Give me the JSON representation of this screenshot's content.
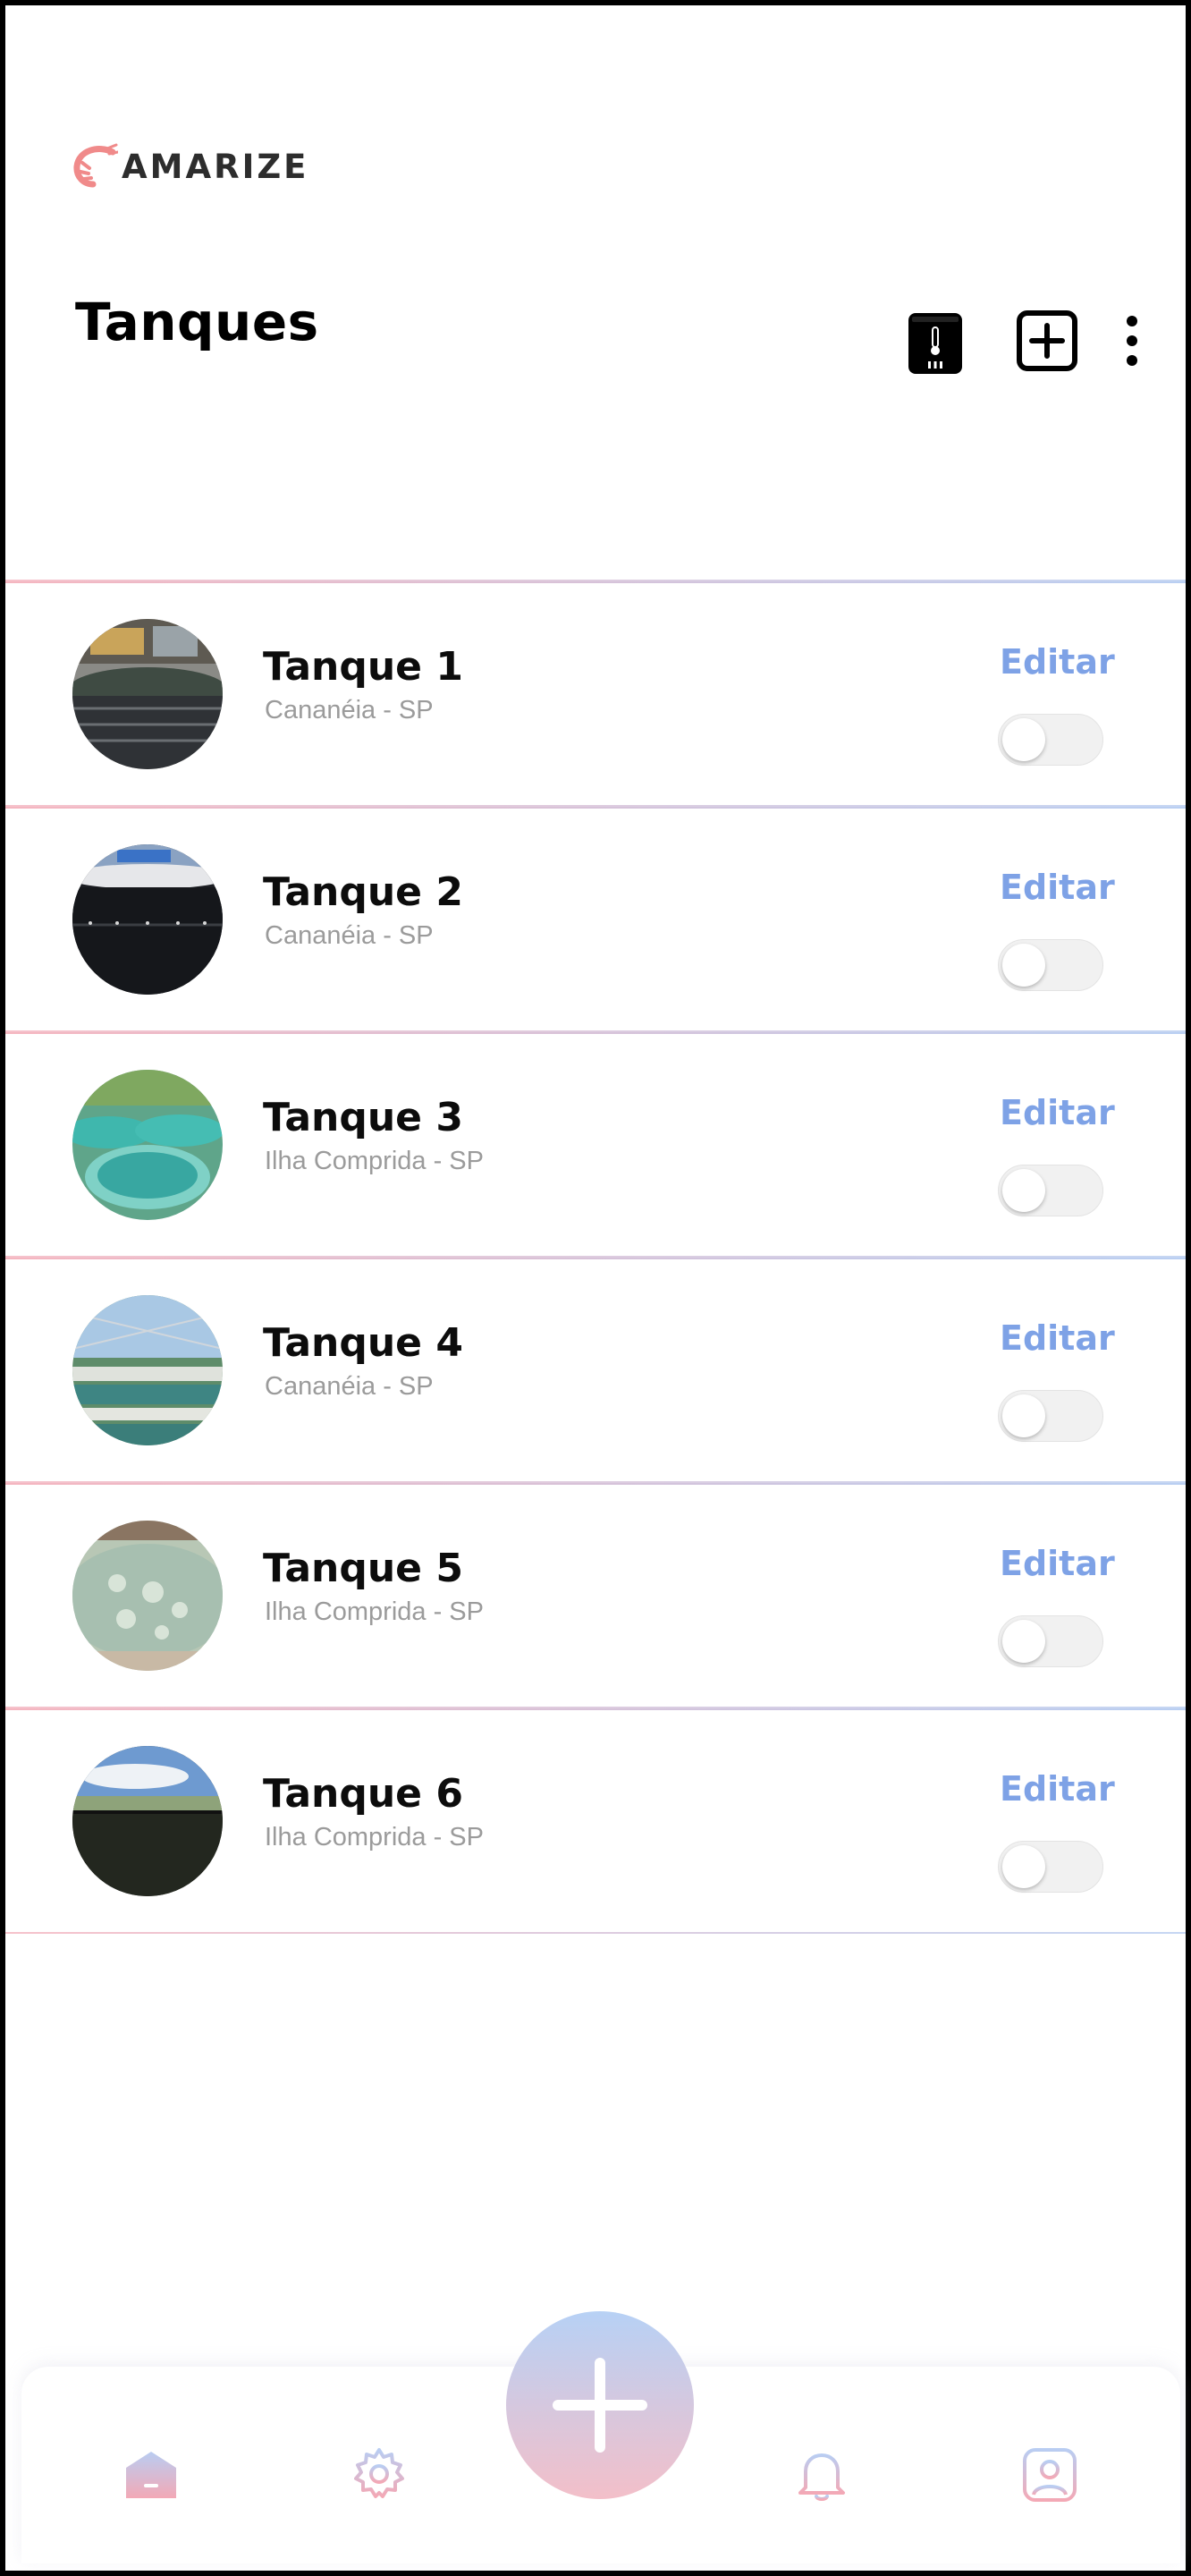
{
  "app": {
    "logo_text": "AMARIZE",
    "brand_color": "#f08a8a"
  },
  "header": {
    "title": "Tanques"
  },
  "tanks": [
    {
      "name": "Tanque 1",
      "location": "Cananéia - SP",
      "edit_label": "Editar",
      "enabled": false
    },
    {
      "name": "Tanque 2",
      "location": "Cananéia - SP",
      "edit_label": "Editar",
      "enabled": false
    },
    {
      "name": "Tanque 3",
      "location": "Ilha Comprida - SP",
      "edit_label": "Editar",
      "enabled": false
    },
    {
      "name": "Tanque 4",
      "location": "Cananéia - SP",
      "edit_label": "Editar",
      "enabled": false
    },
    {
      "name": "Tanque 5",
      "location": "Ilha Comprida - SP",
      "edit_label": "Editar",
      "enabled": false
    },
    {
      "name": "Tanque 6",
      "location": "Ilha Comprida - SP",
      "edit_label": "Editar",
      "enabled": false
    }
  ],
  "bottom_nav": {
    "items": [
      "home-icon",
      "gear-icon",
      "bell-icon",
      "profile-icon"
    ],
    "fab_icon": "plus-icon"
  },
  "colors": {
    "accent_blue": "#7ea2e6",
    "accent_pink": "#f3a9b6"
  }
}
